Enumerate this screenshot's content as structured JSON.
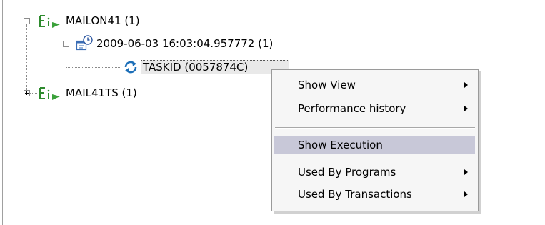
{
  "tree": {
    "nodes": [
      {
        "label": "MAILON41  (1)",
        "icon": "transaction-icon",
        "expanded": true
      },
      {
        "label": "2009-06-03 16:03:04.957772  (1)",
        "icon": "calendar-clock-icon",
        "expanded": true
      },
      {
        "label": "TASKID (0057874C)",
        "icon": "refresh-cycle-icon",
        "selected": true
      },
      {
        "label": "MAIL41TS  (1)",
        "icon": "transaction-icon",
        "expanded": false
      }
    ]
  },
  "context_menu": {
    "items": [
      {
        "label": "Show View",
        "submenu": true
      },
      {
        "label": "Performance history",
        "submenu": true
      },
      {
        "label": "Show Execution",
        "submenu": false,
        "highlighted": true
      },
      {
        "label": "Used By Programs",
        "submenu": true
      },
      {
        "label": "Used By Transactions",
        "submenu": true
      }
    ]
  },
  "colors": {
    "transaction_icon": "#2e8b2e",
    "cycle_icon": "#1d6fb8",
    "menu_highlight": "#c8c8d8"
  }
}
